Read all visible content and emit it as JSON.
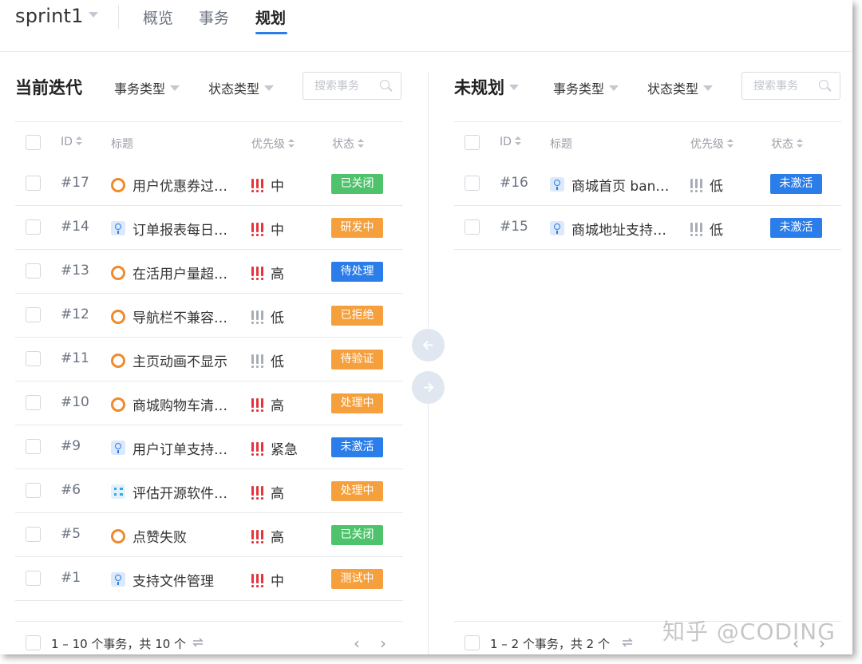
{
  "header": {
    "sprint_name": "sprint1",
    "tabs": [
      "概览",
      "事务",
      "规划"
    ],
    "active_tab": "规划"
  },
  "left_panel": {
    "title": "当前迭代",
    "filters": [
      "事务类型",
      "状态类型"
    ],
    "search_placeholder": "搜索事务",
    "columns": [
      "ID",
      "标题",
      "优先级",
      "状态"
    ],
    "rows": [
      {
        "id": "#17",
        "type": "bug",
        "title": "用户优惠券过…",
        "priority": "中",
        "priority_color": "#e5343a",
        "status": "已关闭",
        "status_color": "#4fc36b"
      },
      {
        "id": "#14",
        "type": "story",
        "title": "订单报表每日…",
        "priority": "中",
        "priority_color": "#e5343a",
        "status": "研发中",
        "status_color": "#f5a03c"
      },
      {
        "id": "#13",
        "type": "bug",
        "title": "在活用户量超…",
        "priority": "高",
        "priority_color": "#e5343a",
        "status": "待处理",
        "status_color": "#2b7de9"
      },
      {
        "id": "#12",
        "type": "bug",
        "title": "导航栏不兼容…",
        "priority": "低",
        "priority_color": "#a8adb5",
        "status": "已拒绝",
        "status_color": "#f5a03c"
      },
      {
        "id": "#11",
        "type": "bug",
        "title": "主页动画不显示",
        "priority": "低",
        "priority_color": "#a8adb5",
        "status": "待验证",
        "status_color": "#f5a03c"
      },
      {
        "id": "#10",
        "type": "bug",
        "title": "商城购物车清…",
        "priority": "高",
        "priority_color": "#e5343a",
        "status": "处理中",
        "status_color": "#f5a03c"
      },
      {
        "id": "#9",
        "type": "story",
        "title": "用户订单支持…",
        "priority": "紧急",
        "priority_color": "#e5343a",
        "status": "未激活",
        "status_color": "#2b7de9"
      },
      {
        "id": "#6",
        "type": "task",
        "title": "评估开源软件…",
        "priority": "高",
        "priority_color": "#e5343a",
        "status": "处理中",
        "status_color": "#f5a03c"
      },
      {
        "id": "#5",
        "type": "bug",
        "title": "点赞失败",
        "priority": "高",
        "priority_color": "#e5343a",
        "status": "已关闭",
        "status_color": "#4fc36b"
      },
      {
        "id": "#1",
        "type": "story",
        "title": "支持文件管理",
        "priority": "中",
        "priority_color": "#e5343a",
        "status": "测试中",
        "status_color": "#f5a03c"
      }
    ],
    "footer": "1 – 10 个事务，共 10 个"
  },
  "right_panel": {
    "title": "未规划",
    "filters": [
      "事务类型",
      "状态类型"
    ],
    "search_placeholder": "搜索事务",
    "columns": [
      "ID",
      "标题",
      "优先级",
      "状态"
    ],
    "rows": [
      {
        "id": "#16",
        "type": "story",
        "title": "商城首页 ban…",
        "priority": "低",
        "priority_color": "#a8adb5",
        "status": "未激活",
        "status_color": "#2b7de9"
      },
      {
        "id": "#15",
        "type": "story",
        "title": "商城地址支持…",
        "priority": "低",
        "priority_color": "#a8adb5",
        "status": "未激活",
        "status_color": "#2b7de9"
      }
    ],
    "footer": "1 – 2 个事务，共 2 个"
  },
  "pager": {
    "prev": "‹",
    "next": "›"
  },
  "watermark": "知乎 @CODING"
}
